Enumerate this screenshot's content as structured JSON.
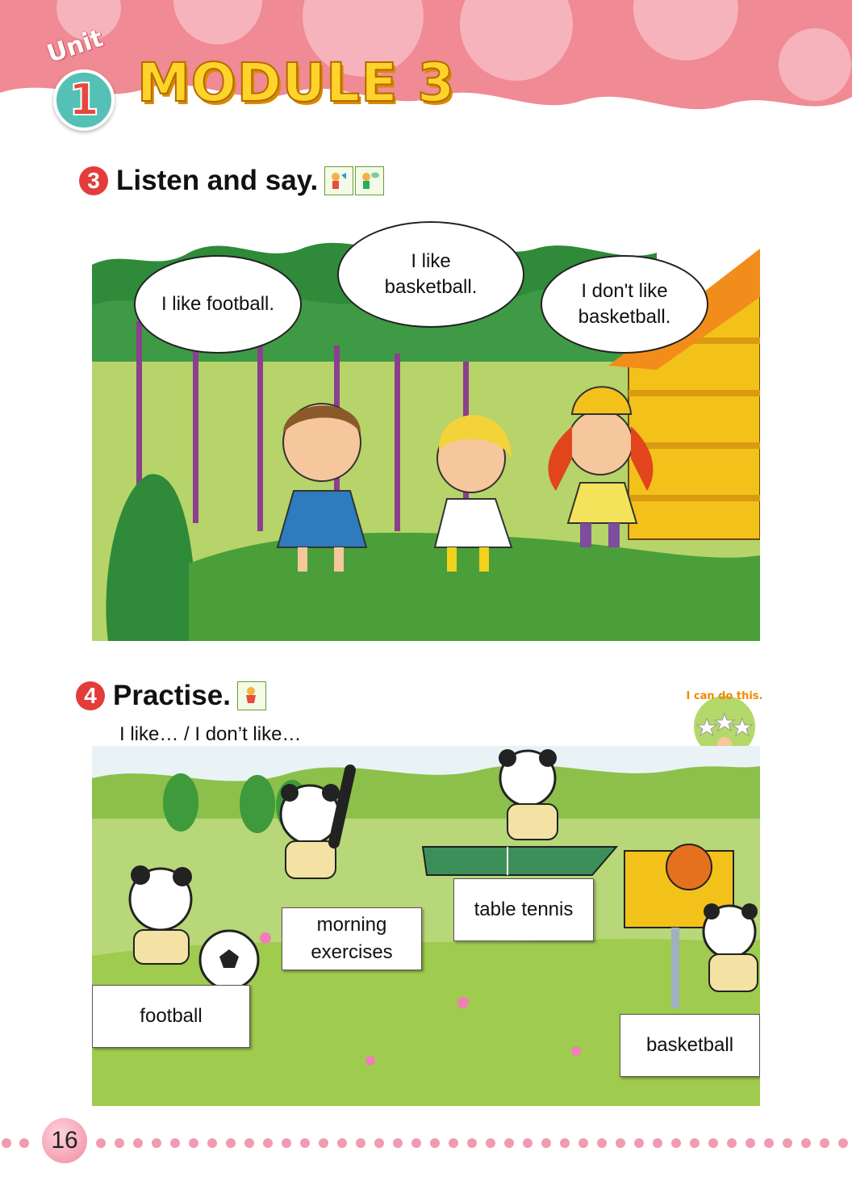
{
  "header": {
    "unit_word": "Unit",
    "unit_number": "1",
    "module_title": "MODULE 3"
  },
  "section3": {
    "number": "3",
    "title": "Listen and say.",
    "bubbles": [
      {
        "line1": "I like football.",
        "line2": ""
      },
      {
        "line1": "I like",
        "line2": "basketball."
      },
      {
        "line1": "I don't like",
        "line2": "basketball."
      }
    ]
  },
  "section4": {
    "number": "4",
    "title": "Practise.",
    "prompt": "I like… / I don’t like…",
    "badge_text": "I can do this.",
    "labels": {
      "football": "football",
      "morning_line1": "morning",
      "morning_line2": "exercises",
      "table_tennis": "table tennis",
      "basketball": "basketball"
    }
  },
  "footer": {
    "page_number": "16"
  },
  "colors": {
    "header_pink": "#f08a94",
    "header_light": "#f7b3bb",
    "section_red": "#e43b3b",
    "grass": "#a8cf5a",
    "forest": "#2f8a3a",
    "house": "#f2c21a"
  },
  "icons": [
    "listen-icon",
    "say-icon",
    "practise-icon",
    "stars-badge-icon"
  ]
}
